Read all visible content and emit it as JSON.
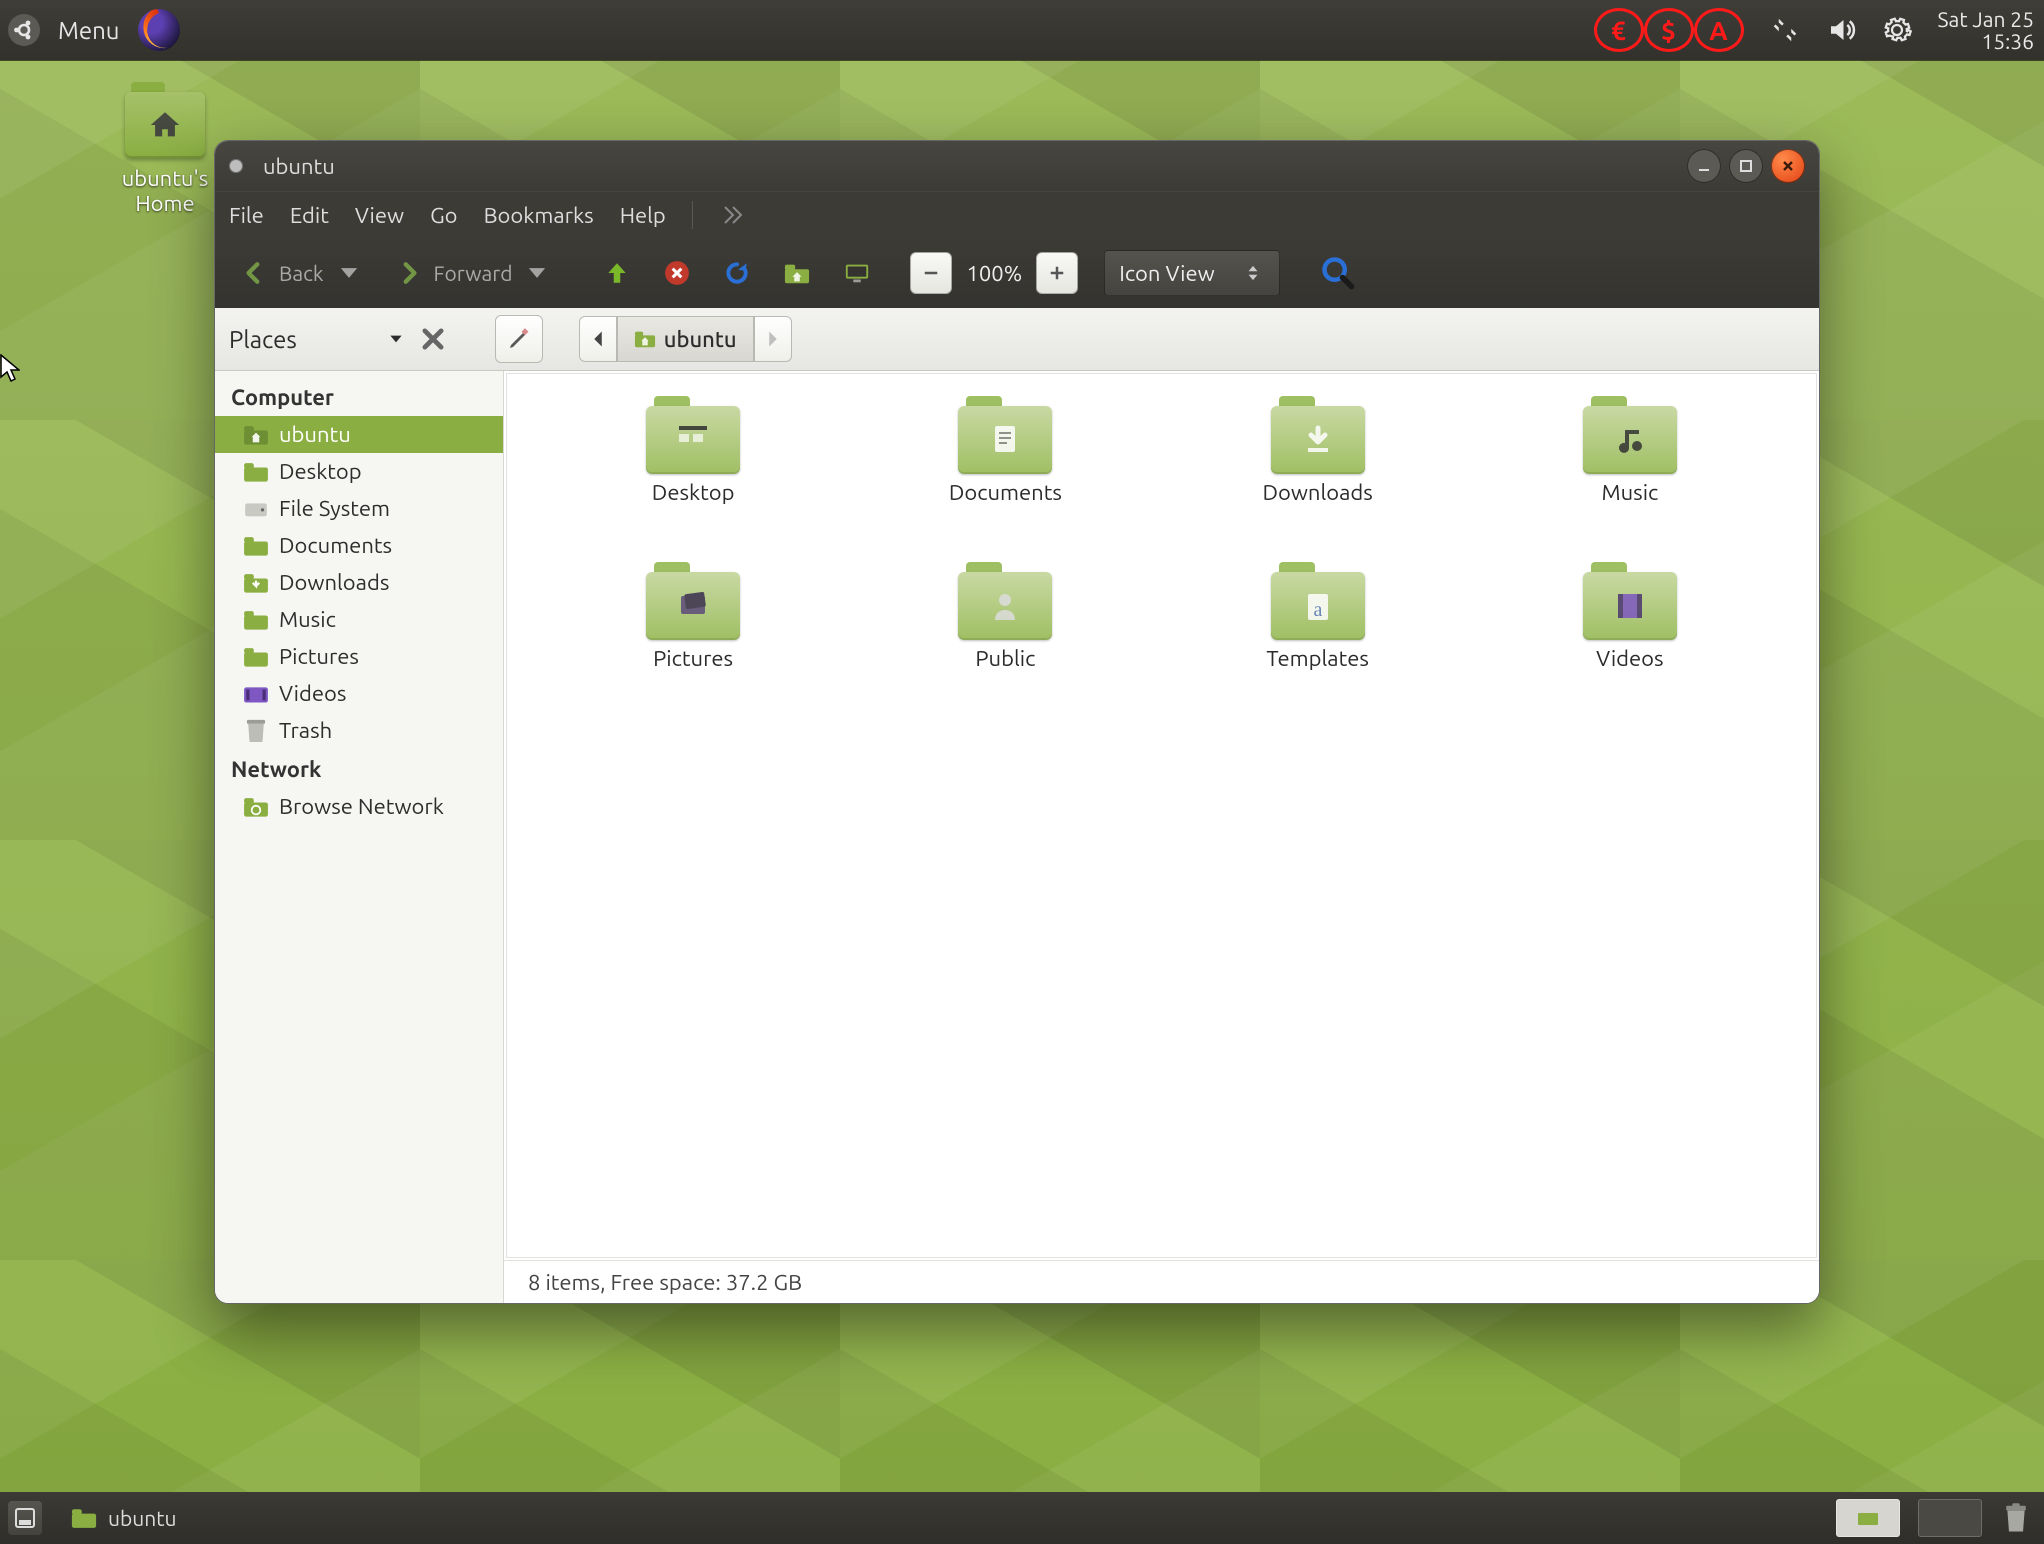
{
  "panel": {
    "menu_label": "Menu",
    "indicators": [
      "€",
      "$",
      "A"
    ],
    "date_line": "Sat Jan 25",
    "time_line": "15:36"
  },
  "desktop": {
    "home_icon_label": "ubuntu's Home"
  },
  "window": {
    "title": "ubuntu",
    "menus": {
      "file": "File",
      "edit": "Edit",
      "view": "View",
      "go": "Go",
      "bookmarks": "Bookmarks",
      "help": "Help"
    },
    "toolbar": {
      "back": "Back",
      "forward": "Forward",
      "zoom": "100%",
      "viewmode": "Icon View"
    },
    "locbar": {
      "places": "Places",
      "crumb": "ubuntu"
    },
    "sidebar": {
      "heading_computer": "Computer",
      "heading_network": "Network",
      "items": [
        {
          "label": "ubuntu"
        },
        {
          "label": "Desktop"
        },
        {
          "label": "File System"
        },
        {
          "label": "Documents"
        },
        {
          "label": "Downloads"
        },
        {
          "label": "Music"
        },
        {
          "label": "Pictures"
        },
        {
          "label": "Videos"
        },
        {
          "label": "Trash"
        }
      ],
      "network_item": "Browse Network"
    },
    "folders": [
      {
        "label": "Desktop",
        "kind": "desktop"
      },
      {
        "label": "Documents",
        "kind": "documents"
      },
      {
        "label": "Downloads",
        "kind": "downloads"
      },
      {
        "label": "Music",
        "kind": "music"
      },
      {
        "label": "Pictures",
        "kind": "pictures"
      },
      {
        "label": "Public",
        "kind": "public"
      },
      {
        "label": "Templates",
        "kind": "templates"
      },
      {
        "label": "Videos",
        "kind": "videos"
      }
    ],
    "status": "8 items, Free space: 37.2 GB"
  },
  "taskbar": {
    "task_label": "ubuntu"
  }
}
